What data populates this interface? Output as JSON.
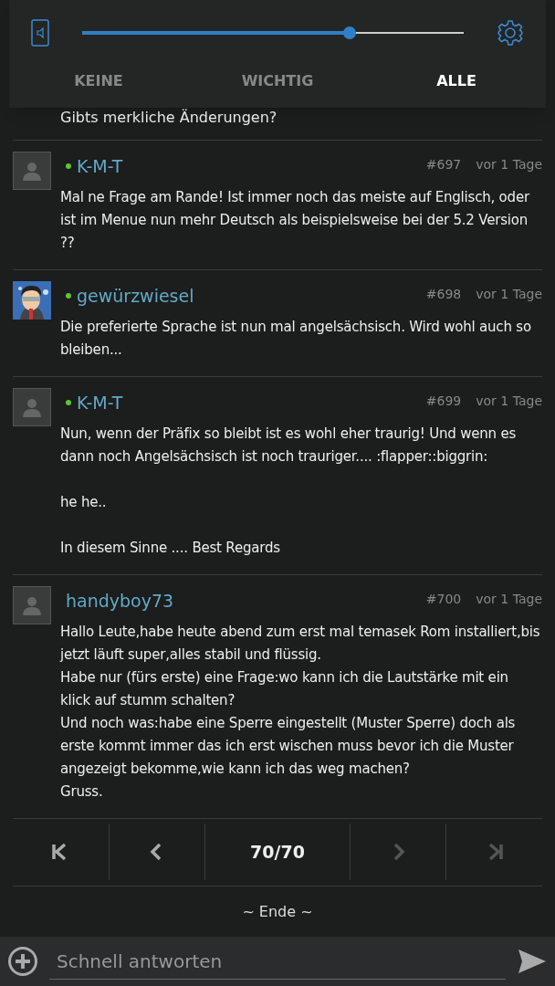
{
  "volume_panel": {
    "level": 0.7,
    "tabs": [
      {
        "label": "KEINE",
        "selected": false
      },
      {
        "label": "WICHTIG",
        "selected": false
      },
      {
        "label": "ALLE",
        "selected": true
      }
    ]
  },
  "partial_text": "Gibts merkliche Änderungen?",
  "posts": [
    {
      "author": "K-M-T",
      "online": true,
      "kind": "placeholder",
      "number": "#697",
      "time": "vor 1 Tage",
      "body": "Mal ne Frage am Rande! Ist immer noch das meiste auf Englisch, oder ist im Menue nun mehr Deutsch als beispielsweise bei der 5.2 Version ??"
    },
    {
      "author": "gewürzwiesel",
      "online": true,
      "kind": "picture",
      "number": "#698",
      "time": "vor 1 Tage",
      "body": "Die preferierte Sprache ist nun mal angelsächsisch. Wird wohl auch so bleiben..."
    },
    {
      "author": "K-M-T",
      "online": true,
      "kind": "placeholder",
      "number": "#699",
      "time": "vor 1 Tage",
      "body": "Nun, wenn der Präfix so bleibt ist es wohl eher traurig! Und wenn es dann noch Angelsächsisch ist noch trauriger.... :flapper::biggrin:\n\nhe he..\n\nIn diesem Sinne .... Best Regards"
    },
    {
      "author": "handyboy73",
      "online": false,
      "kind": "placeholder",
      "number": "#700",
      "time": "vor 1 Tage",
      "body": "Hallo Leute,habe heute abend zum erst mal temasek Rom installiert,bis jetzt läuft super,alles stabil und flüssig.\nHabe nur (fürs erste) eine Frage:wo kann ich die Lautstärke mit ein klick auf stumm schalten?\nUnd noch was:habe eine Sperre eingestellt (Muster Sperre) doch als erste kommt immer das ich erst wischen muss bevor ich die Muster angezeigt bekomme,wie kann ich das weg machen?\nGruss."
    }
  ],
  "pagination": {
    "buttons": [
      {
        "kind": "first",
        "disabled": false
      },
      {
        "kind": "prev",
        "disabled": false
      },
      {
        "kind": "page",
        "label": "70/70"
      },
      {
        "kind": "next",
        "disabled": true
      },
      {
        "kind": "last",
        "disabled": true
      }
    ]
  },
  "end_label": "~ Ende ~",
  "reply": {
    "placeholder": "Schnell antworten"
  }
}
